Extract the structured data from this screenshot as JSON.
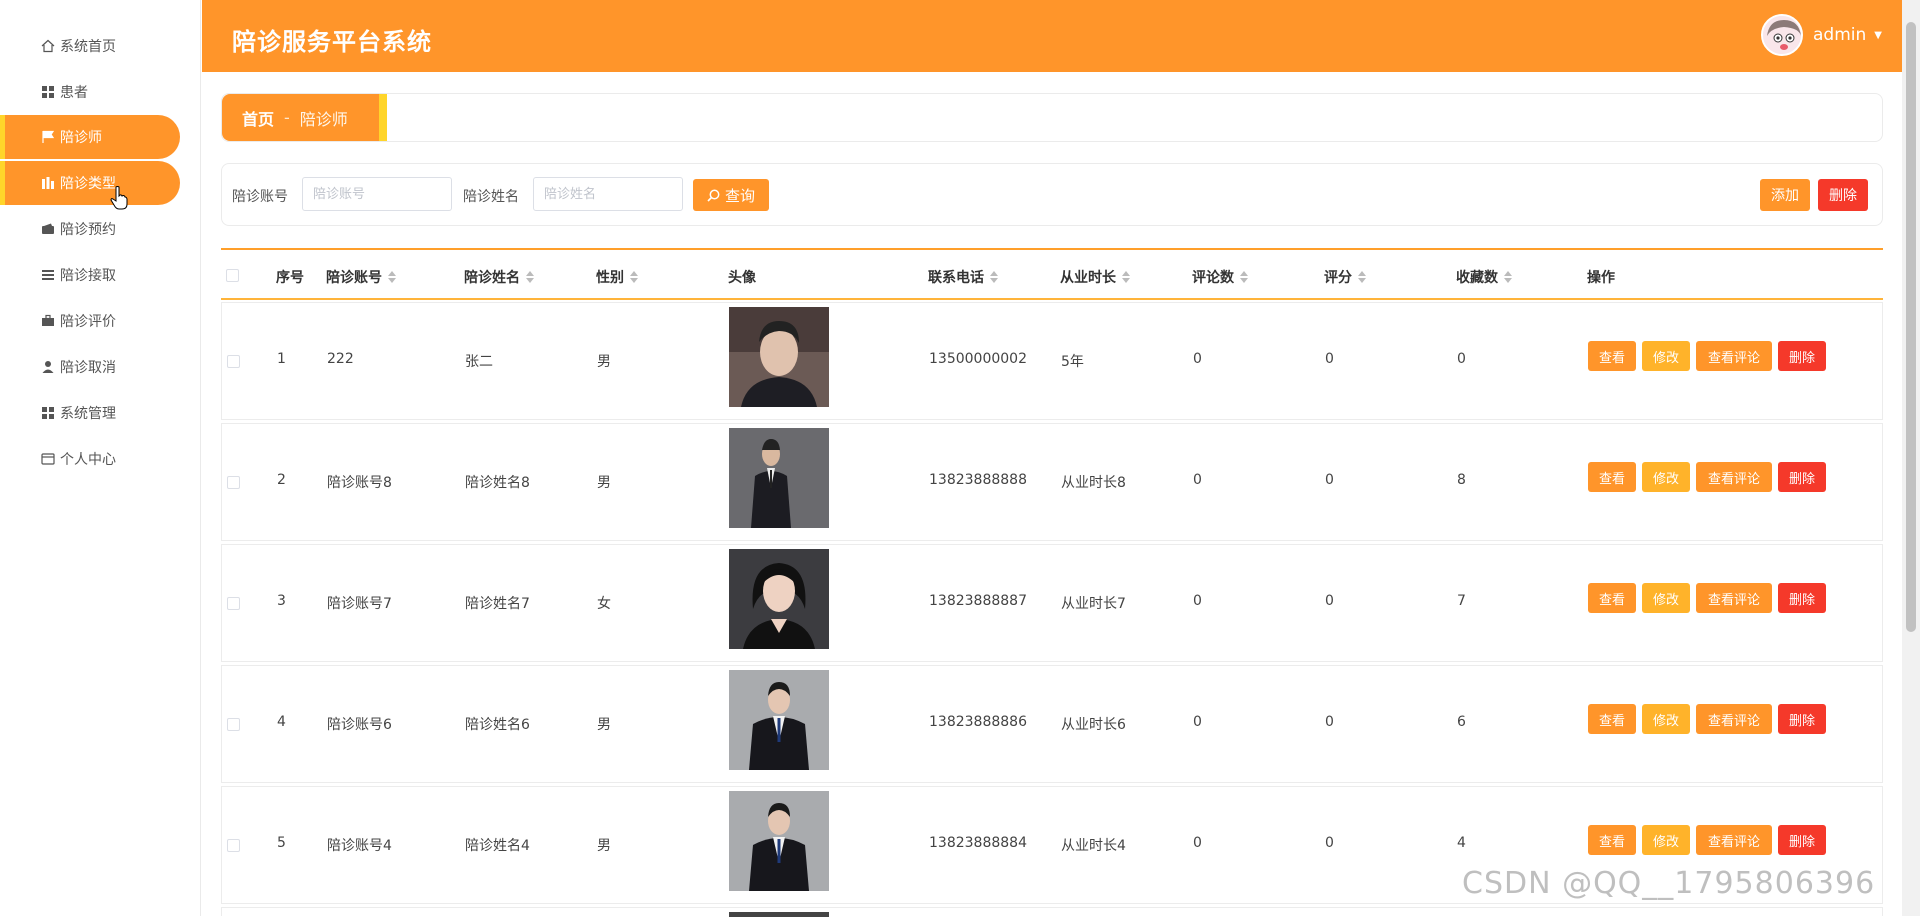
{
  "app": {
    "title": "陪诊服务平台系统",
    "user": "admin"
  },
  "sidebar": {
    "items": [
      {
        "label": "系统首页",
        "icon": "home-icon"
      },
      {
        "label": "患者",
        "icon": "grid-icon"
      },
      {
        "label": "陪诊师",
        "icon": "flag-icon",
        "active": true
      },
      {
        "label": "陪诊类型",
        "icon": "chart-icon",
        "active": true
      },
      {
        "label": "陪诊预约",
        "icon": "wallet-icon"
      },
      {
        "label": "陪诊接取",
        "icon": "list-icon"
      },
      {
        "label": "陪诊评价",
        "icon": "briefcase-icon"
      },
      {
        "label": "陪诊取消",
        "icon": "user-icon"
      },
      {
        "label": "系统管理",
        "icon": "grid-icon"
      },
      {
        "label": "个人中心",
        "icon": "card-icon"
      }
    ]
  },
  "breadcrumb": {
    "home": "首页",
    "separator": "-",
    "current": "陪诊师"
  },
  "search": {
    "account_label": "陪诊账号",
    "account_placeholder": "陪诊账号",
    "name_label": "陪诊姓名",
    "name_placeholder": "陪诊姓名",
    "query_label": "查询",
    "add_label": "添加",
    "delete_label": "删除"
  },
  "table": {
    "columns": [
      "序号",
      "陪诊账号",
      "陪诊姓名",
      "性别",
      "头像",
      "联系电话",
      "从业时长",
      "评论数",
      "评分",
      "收藏数",
      "操作"
    ],
    "rows": [
      {
        "index": "1",
        "account": "222",
        "name": "张二",
        "gender": "男",
        "phone": "13500000002",
        "years": "5年",
        "comments": "0",
        "score": "0",
        "favorites": "0"
      },
      {
        "index": "2",
        "account": "陪诊账号8",
        "name": "陪诊姓名8",
        "gender": "男",
        "phone": "13823888888",
        "years": "从业时长8",
        "comments": "0",
        "score": "0",
        "favorites": "8"
      },
      {
        "index": "3",
        "account": "陪诊账号7",
        "name": "陪诊姓名7",
        "gender": "女",
        "phone": "13823888887",
        "years": "从业时长7",
        "comments": "0",
        "score": "0",
        "favorites": "7"
      },
      {
        "index": "4",
        "account": "陪诊账号6",
        "name": "陪诊姓名6",
        "gender": "男",
        "phone": "13823888886",
        "years": "从业时长6",
        "comments": "0",
        "score": "0",
        "favorites": "6"
      },
      {
        "index": "5",
        "account": "陪诊账号4",
        "name": "陪诊姓名4",
        "gender": "男",
        "phone": "13823888884",
        "years": "从业时长4",
        "comments": "0",
        "score": "0",
        "favorites": "4"
      }
    ],
    "actions": {
      "view": "查看",
      "edit": "修改",
      "comments": "查看评论",
      "delete": "删除"
    }
  },
  "watermark": "CSDN @QQ__1795806396",
  "colors": {
    "primary": "#ff952a",
    "accent": "#ffd52a",
    "danger": "#f5392a"
  }
}
